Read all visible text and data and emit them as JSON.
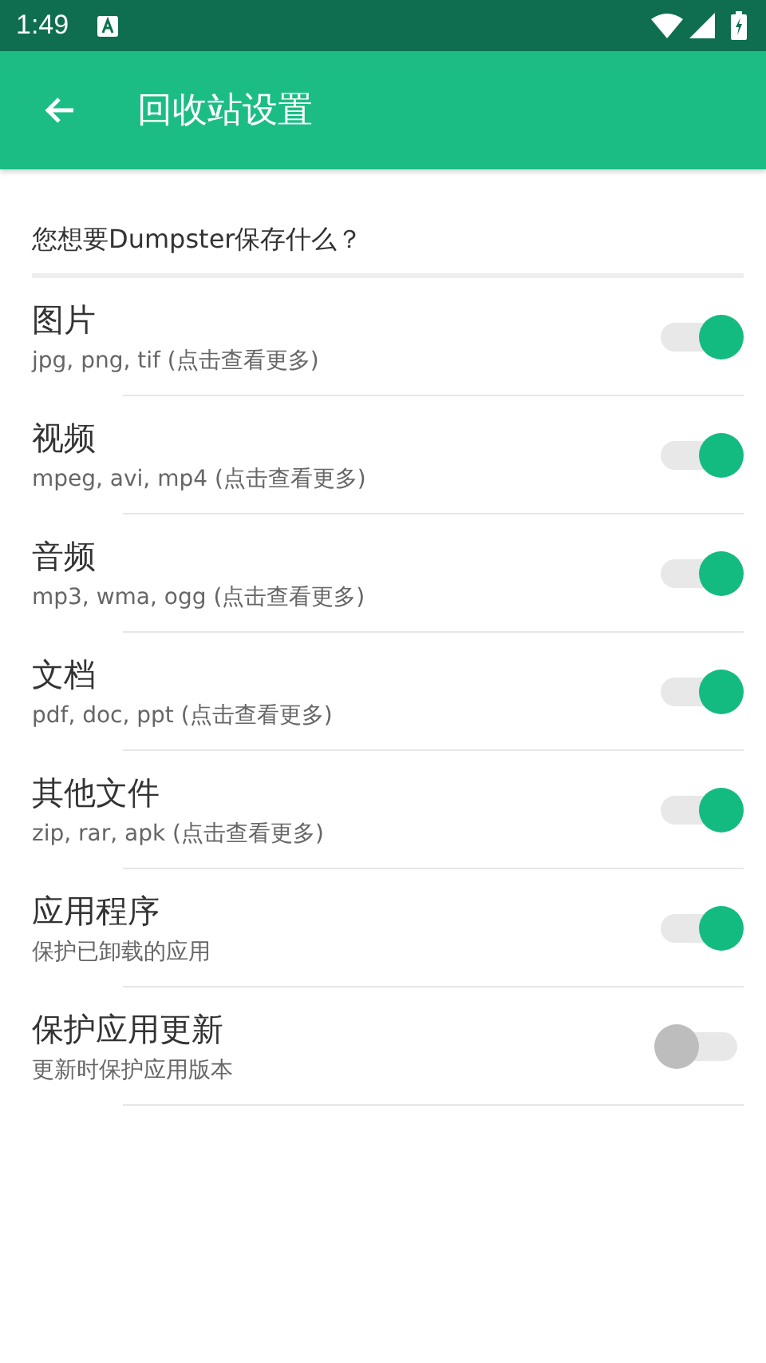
{
  "status_bar": {
    "time": "1:49"
  },
  "toolbar": {
    "title": "回收站设置"
  },
  "section": {
    "title": "您想要Dumpster保存什么？"
  },
  "settings": [
    {
      "title": "图片",
      "subtitle": "jpg, png, tif (点击查看更多)",
      "on": true
    },
    {
      "title": "视频",
      "subtitle": "mpeg, avi, mp4 (点击查看更多)",
      "on": true
    },
    {
      "title": "音频",
      "subtitle": "mp3, wma, ogg (点击查看更多)",
      "on": true
    },
    {
      "title": "文档",
      "subtitle": "pdf, doc, ppt (点击查看更多)",
      "on": true
    },
    {
      "title": "其他文件",
      "subtitle": "zip, rar, apk (点击查看更多)",
      "on": true
    },
    {
      "title": "应用程序",
      "subtitle": "保护已卸载的应用",
      "on": true
    },
    {
      "title": "保护应用更新",
      "subtitle": "更新时保护应用版本",
      "on": false
    }
  ]
}
